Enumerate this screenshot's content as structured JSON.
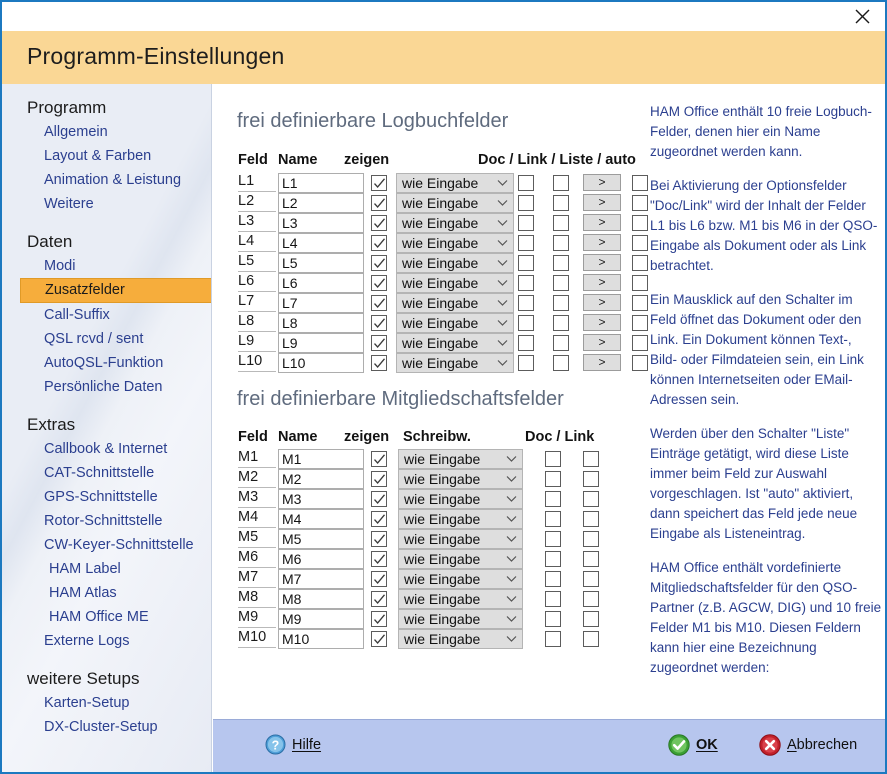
{
  "window": {
    "title": "Programm-Einstellungen",
    "close_icon": "close-icon"
  },
  "sidebar": {
    "groups": [
      {
        "title": "Programm",
        "items": [
          {
            "label": "Allgemein",
            "selected": false
          },
          {
            "label": "Layout & Farben",
            "selected": false
          },
          {
            "label": "Animation & Leistung",
            "selected": false
          },
          {
            "label": "Weitere",
            "selected": false
          }
        ]
      },
      {
        "title": "Daten",
        "items": [
          {
            "label": "Modi",
            "selected": false
          },
          {
            "label": "Zusatzfelder",
            "selected": true
          },
          {
            "label": "Call-Suffix",
            "selected": false
          },
          {
            "label": "QSL rcvd / sent",
            "selected": false
          },
          {
            "label": "AutoQSL-Funktion",
            "selected": false
          },
          {
            "label": "Persönliche Daten",
            "selected": false
          }
        ]
      },
      {
        "title": "Extras",
        "items": [
          {
            "label": "Callbook & Internet",
            "selected": false
          },
          {
            "label": "CAT-Schnittstelle",
            "selected": false
          },
          {
            "label": "GPS-Schnittstelle",
            "selected": false
          },
          {
            "label": "Rotor-Schnittstelle",
            "selected": false
          },
          {
            "label": "CW-Keyer-Schnittstelle",
            "selected": false
          },
          {
            "label": "HAM Label",
            "selected": false
          },
          {
            "label": "HAM Atlas",
            "selected": false
          },
          {
            "label": "HAM Office ME",
            "selected": false
          },
          {
            "label": "Externe Logs",
            "selected": false
          }
        ]
      },
      {
        "title": "weitere Setups",
        "items": [
          {
            "label": "Karten-Setup",
            "selected": false
          },
          {
            "label": "DX-Cluster-Setup",
            "selected": false
          }
        ]
      }
    ]
  },
  "logbook_section": {
    "title": "frei definierbare Logbuchfelder",
    "headers": {
      "feld": "Feld",
      "name": "Name",
      "zeigen": "zeigen",
      "options": "Doc / Link / Liste / auto"
    },
    "select_value": "wie Eingabe",
    "list_button_label": ">",
    "rows": [
      {
        "feld": "L1",
        "name": "L1",
        "zeigen": true,
        "schreibw": "wie Eingabe",
        "doc": false,
        "link": false,
        "auto": false
      },
      {
        "feld": "L2",
        "name": "L2",
        "zeigen": true,
        "schreibw": "wie Eingabe",
        "doc": false,
        "link": false,
        "auto": false
      },
      {
        "feld": "L3",
        "name": "L3",
        "zeigen": true,
        "schreibw": "wie Eingabe",
        "doc": false,
        "link": false,
        "auto": false
      },
      {
        "feld": "L4",
        "name": "L4",
        "zeigen": true,
        "schreibw": "wie Eingabe",
        "doc": false,
        "link": false,
        "auto": false
      },
      {
        "feld": "L5",
        "name": "L5",
        "zeigen": true,
        "schreibw": "wie Eingabe",
        "doc": false,
        "link": false,
        "auto": false
      },
      {
        "feld": "L6",
        "name": "L6",
        "zeigen": true,
        "schreibw": "wie Eingabe",
        "doc": false,
        "link": false,
        "auto": false
      },
      {
        "feld": "L7",
        "name": "L7",
        "zeigen": true,
        "schreibw": "wie Eingabe",
        "doc": false,
        "link": false,
        "auto": false
      },
      {
        "feld": "L8",
        "name": "L8",
        "zeigen": true,
        "schreibw": "wie Eingabe",
        "doc": false,
        "link": false,
        "auto": false
      },
      {
        "feld": "L9",
        "name": "L9",
        "zeigen": true,
        "schreibw": "wie Eingabe",
        "doc": false,
        "link": false,
        "auto": false
      },
      {
        "feld": "L10",
        "name": "L10",
        "zeigen": true,
        "schreibw": "wie Eingabe",
        "doc": false,
        "link": false,
        "auto": false
      }
    ]
  },
  "membership_section": {
    "title": "frei definierbare Mitgliedschaftsfelder",
    "headers": {
      "feld": "Feld",
      "name": "Name",
      "zeigen": "zeigen",
      "schreibw": "Schreibw.",
      "options": "Doc / Link"
    },
    "select_value": "wie Eingabe",
    "rows": [
      {
        "feld": "M1",
        "name": "M1",
        "zeigen": true,
        "schreibw": "wie Eingabe",
        "doc": false,
        "link": false
      },
      {
        "feld": "M2",
        "name": "M2",
        "zeigen": true,
        "schreibw": "wie Eingabe",
        "doc": false,
        "link": false
      },
      {
        "feld": "M3",
        "name": "M3",
        "zeigen": true,
        "schreibw": "wie Eingabe",
        "doc": false,
        "link": false
      },
      {
        "feld": "M4",
        "name": "M4",
        "zeigen": true,
        "schreibw": "wie Eingabe",
        "doc": false,
        "link": false
      },
      {
        "feld": "M5",
        "name": "M5",
        "zeigen": true,
        "schreibw": "wie Eingabe",
        "doc": false,
        "link": false
      },
      {
        "feld": "M6",
        "name": "M6",
        "zeigen": true,
        "schreibw": "wie Eingabe",
        "doc": false,
        "link": false
      },
      {
        "feld": "M7",
        "name": "M7",
        "zeigen": true,
        "schreibw": "wie Eingabe",
        "doc": false,
        "link": false
      },
      {
        "feld": "M8",
        "name": "M8",
        "zeigen": true,
        "schreibw": "wie Eingabe",
        "doc": false,
        "link": false
      },
      {
        "feld": "M9",
        "name": "M9",
        "zeigen": true,
        "schreibw": "wie Eingabe",
        "doc": false,
        "link": false
      },
      {
        "feld": "M10",
        "name": "M10",
        "zeigen": true,
        "schreibw": "wie Eingabe",
        "doc": false,
        "link": false
      }
    ]
  },
  "help": {
    "paragraphs": [
      "HAM Office enthält 10 freie Logbuch- Felder, denen hier ein Name zugeordnet werden kann.",
      "Bei Aktivierung der Optionsfelder \"Doc/Link\" wird der Inhalt der Felder L1 bis L6 bzw. M1 bis M6 in der QSO-Eingabe als Dokument oder als Link betrachtet.",
      "Ein Mausklick auf den Schalter im Feld öffnet das Dokument oder den Link. Ein Dokument können Text-, Bild- oder Filmdateien sein, ein Link können Internetseiten oder EMail-Adressen sein.",
      "Werden über den Schalter \"Liste\" Einträge getätigt, wird diese Liste immer beim Feld zur Auswahl vorgeschlagen. Ist \"auto\" aktiviert, dann speichert das Feld jede neue Eingabe als Listeneintrag.",
      "HAM Office enthält vordefinierte Mitgliedschaftsfelder für den QSO-Partner (z.B. AGCW, DIG) und  10 freie Felder  M1 bis M10. Diesen Feldern kann hier eine Bezeichnung zugeordnet werden:"
    ]
  },
  "footer": {
    "help_label": "Hilfe",
    "ok_label": "OK",
    "cancel_label": "Abbrechen"
  },
  "colors": {
    "accent_header": "#fad795",
    "selected_nav": "#f6ad3c",
    "link_blue": "#2b3f8f",
    "footer": "#b7c6ee",
    "border": "#1c79c0",
    "ok_green": "#3aa033",
    "cancel_red": "#c2202a"
  }
}
